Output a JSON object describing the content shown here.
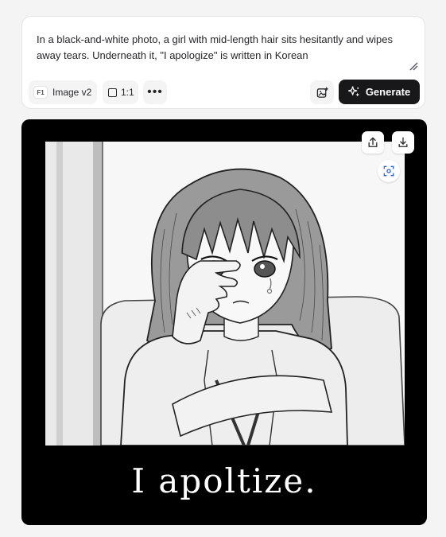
{
  "prompt": {
    "text": "In a black-and-white photo, a girl with mid-length hair sits hesitantly and wipes away tears. Underneath it, \"I apologize\" is written in Korean"
  },
  "toolbar": {
    "model_badge": "F1",
    "model_label": "Image v2",
    "ratio_label": "1:1",
    "more_label": "•••",
    "generate_label": "Generate"
  },
  "image": {
    "caption": "I apoltize.",
    "actions": [
      "share-icon",
      "download-icon",
      "scan-icon"
    ]
  },
  "colors": {
    "background": "#f4f4f5",
    "generate_bg": "#18181b",
    "scan_accent": "#2563eb"
  }
}
